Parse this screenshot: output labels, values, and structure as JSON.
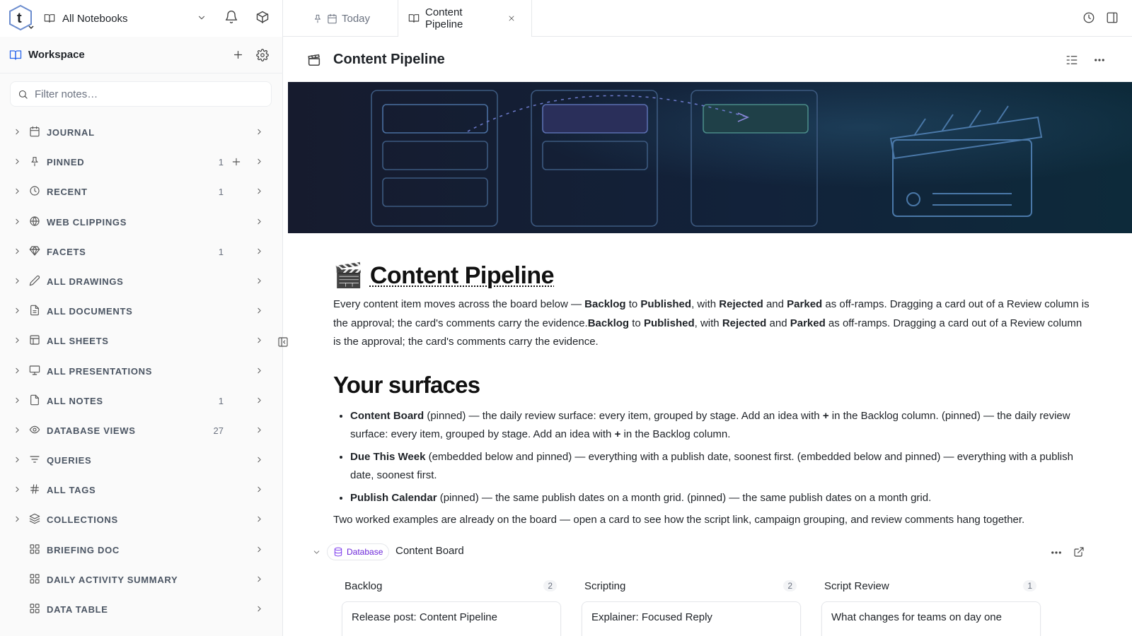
{
  "topbar": {
    "notebook_selector": "All Notebooks",
    "tabs": [
      {
        "label": "Today",
        "active": false
      },
      {
        "label": "Content Pipeline",
        "active": true
      }
    ]
  },
  "sidebar": {
    "title": "Workspace",
    "filter_placeholder": "Filter notes…",
    "items": [
      {
        "label": "JOURNAL",
        "icon": "calendar-icon",
        "count": ""
      },
      {
        "label": "PINNED",
        "icon": "pin-icon",
        "count": "1"
      },
      {
        "label": "RECENT",
        "icon": "clock-icon",
        "count": "1"
      },
      {
        "label": "WEB CLIPPINGS",
        "icon": "globe-icon",
        "count": ""
      },
      {
        "label": "FACETS",
        "icon": "gem-icon",
        "count": "1"
      },
      {
        "label": "ALL DRAWINGS",
        "icon": "pencil-icon",
        "count": ""
      },
      {
        "label": "ALL DOCUMENTS",
        "icon": "document-icon",
        "count": ""
      },
      {
        "label": "ALL SHEETS",
        "icon": "table-icon",
        "count": ""
      },
      {
        "label": "ALL PRESENTATIONS",
        "icon": "presentation-icon",
        "count": ""
      },
      {
        "label": "ALL NOTES",
        "icon": "note-icon",
        "count": "1"
      },
      {
        "label": "DATABASE VIEWS",
        "icon": "eye-icon",
        "count": "27"
      },
      {
        "label": "QUERIES",
        "icon": "filter-icon",
        "count": ""
      },
      {
        "label": "ALL TAGS",
        "icon": "hash-icon",
        "count": ""
      },
      {
        "label": "COLLECTIONS",
        "icon": "layers-icon",
        "count": ""
      },
      {
        "label": "BRIEFING DOC",
        "icon": "grid-icon",
        "count": ""
      },
      {
        "label": "DAILY ACTIVITY SUMMARY",
        "icon": "grid-icon",
        "count": ""
      },
      {
        "label": "DATA TABLE",
        "icon": "grid-icon",
        "count": ""
      }
    ]
  },
  "document": {
    "header_title": "Content Pipeline",
    "h1_emoji": "🎬",
    "h1": "Content Pipeline",
    "intro": {
      "p1": "Every content item moves across the board below — ",
      "b1": "Backlog",
      "p2": " to ",
      "b2": "Published",
      "p3": ", with ",
      "b3": "Rejected",
      "p4": " and ",
      "b4": "Parked",
      "p5": " as off-ramps. Dragging a card out of a Review column is the approval; the card's comments carry the evidence.",
      "b5": "Backlog",
      "p6": " to ",
      "b6": "Published",
      "p7": ", with ",
      "b7": "Rejected",
      "p8": " and ",
      "b8": "Parked",
      "p9": " as off-ramps. Dragging a card out of a Review column is the approval; the card's comments carry the evidence."
    },
    "h2": "Your surfaces",
    "bullets": [
      {
        "bold": "Content Board",
        "t1": " (pinned) — the daily review surface: every item, grouped by stage. Add an idea with ",
        "plus": "+",
        "t2": " in the Backlog column. (pinned) — the daily review surface: every item, grouped by stage. Add an idea with ",
        "plus2": "+",
        "t3": " in the Backlog column."
      },
      {
        "bold": "Due This Week",
        "text": " (embedded below and pinned) — everything with a publish date, soonest first. (embedded below and pinned) — everything with a publish date, soonest first."
      },
      {
        "bold": "Publish Calendar",
        "text": " (pinned) — the same publish dates on a month grid. (pinned) — the same publish dates on a month grid."
      }
    ],
    "examples": "Two worked examples are already on the board — open a card to see how the script link, campaign grouping, and review comments hang together."
  },
  "database": {
    "chip": "Database",
    "title": "Content Board",
    "columns": [
      {
        "name": "Backlog",
        "count": "2",
        "first_card": "Release post: Content Pipeline"
      },
      {
        "name": "Scripting",
        "count": "2",
        "first_card": "Explainer: Focused Reply"
      },
      {
        "name": "Script Review",
        "count": "1",
        "first_card": "What changes for teams on day one"
      }
    ]
  },
  "colors": {
    "accent": "#2563eb",
    "database_chip": "#6d28d9",
    "banner_bg": "#0f1c2e"
  }
}
